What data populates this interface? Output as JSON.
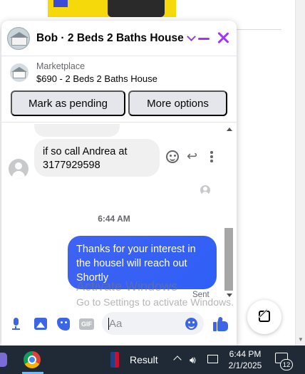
{
  "chat": {
    "title": "Bob · 2 Beds 2 Baths House",
    "marketplace": {
      "label": "Marketplace",
      "item": "$690 - 2 Beds 2 Baths House"
    },
    "buttons": {
      "mark_pending": "Mark as pending",
      "more_options": "More options"
    },
    "messages": [
      {
        "direction": "incoming",
        "text": "if so call Andrea at 3177929598"
      },
      {
        "direction": "outgoing",
        "text": "Thanks for your interest in the housel will reach out Shortly"
      }
    ],
    "timestamp": "6:44 AM",
    "status": "Sent",
    "composer": {
      "gif_label": "GIF",
      "placeholder": "Aa"
    },
    "accent_color": "#a033ff",
    "bubble_color": "#3f63f2"
  },
  "watermark": {
    "line1": "Activate Windows",
    "line2": "Go to Settings to activate Windows."
  },
  "taskbar": {
    "app_label": "Result",
    "time": "6:44 PM",
    "date": "2/1/2025",
    "notification_count": "12"
  }
}
